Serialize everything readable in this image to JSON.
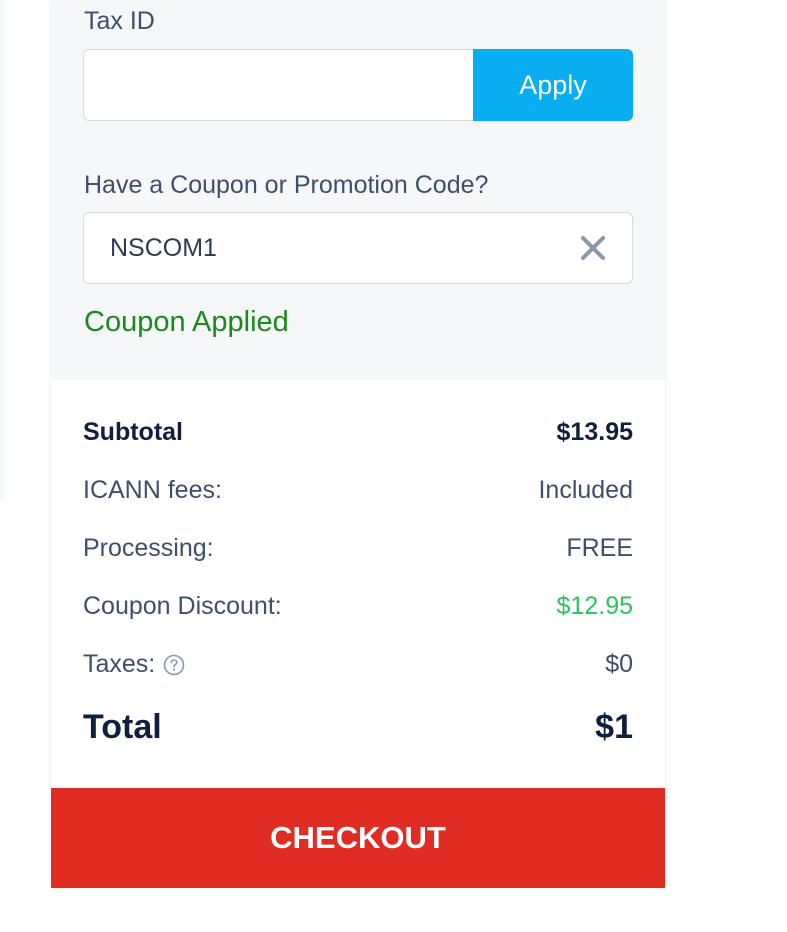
{
  "tax_id": {
    "label": "Tax ID",
    "value": "",
    "apply_label": "Apply"
  },
  "coupon": {
    "label": "Have a Coupon or Promotion Code?",
    "value": "NSCOM1",
    "status": "Coupon Applied"
  },
  "summary": {
    "subtotal_label": "Subtotal",
    "subtotal_value": "$13.95",
    "icann_label": "ICANN fees:",
    "icann_value": "Included",
    "processing_label": "Processing:",
    "processing_value": "FREE",
    "coupon_discount_label": "Coupon Discount:",
    "coupon_discount_value": "$12.95",
    "taxes_label": "Taxes:",
    "taxes_value": "$0",
    "total_label": "Total",
    "total_value": "$1"
  },
  "checkout_label": "CHECKOUT",
  "icons": {
    "clear": "close-icon",
    "taxes_help": "question-circle-icon"
  },
  "colors": {
    "apply_button": "#08aef0",
    "checkout_button": "#e12c23",
    "coupon_applied": "#1a8a1a",
    "discount": "#2bc25f",
    "heading_text": "#0f1f3d",
    "body_text": "#3d4f6b",
    "panel_bg": "#f5f7f9"
  }
}
